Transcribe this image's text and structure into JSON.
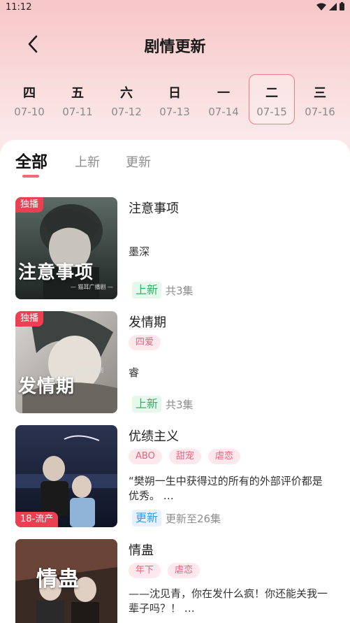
{
  "status_bar": {
    "time": "11:12"
  },
  "header": {
    "title": "剧情更新"
  },
  "days": [
    {
      "week": "四",
      "date": "07-10",
      "selected": false
    },
    {
      "week": "五",
      "date": "07-11",
      "selected": false
    },
    {
      "week": "六",
      "date": "07-12",
      "selected": false
    },
    {
      "week": "日",
      "date": "07-13",
      "selected": false
    },
    {
      "week": "一",
      "date": "07-14",
      "selected": false
    },
    {
      "week": "二",
      "date": "07-15",
      "selected": true
    },
    {
      "week": "三",
      "date": "07-16",
      "selected": false
    }
  ],
  "tabs": [
    {
      "label": "全部",
      "active": true
    },
    {
      "label": "上新",
      "active": false
    },
    {
      "label": "更新",
      "active": false
    }
  ],
  "items": [
    {
      "title": "注意事项",
      "cover_badge": "独播",
      "cover_title": "注意事项",
      "cover_sub": "— 猫耳广播剧 —",
      "tags": [],
      "desc": "墨深",
      "status": "上新",
      "episodes": "共3集"
    },
    {
      "title": "发情期",
      "cover_badge": "独播",
      "cover_title": "发情期",
      "cover_sub": "猫耳广播剧",
      "tags": [
        "四爱"
      ],
      "desc": "睿",
      "status": "上新",
      "episodes": "共3集"
    },
    {
      "title": "优绩主义",
      "cover_badge": "18-流产",
      "cover_title": "",
      "cover_sub": "",
      "tags": [
        "ABO",
        "甜宠",
        "虐恋"
      ],
      "desc": "“樊朔一生中获得过的所有的外部评价都是优秀。 …",
      "status": "更新",
      "episodes": "更新至26集"
    },
    {
      "title": "情蛊",
      "cover_badge": "",
      "cover_title": "情蛊",
      "cover_sub": "",
      "tags": [
        "年下",
        "虐恋"
      ],
      "desc": "——沈见青，你在发什么疯！你还能关我一辈子吗？！ …",
      "status": "",
      "episodes": ""
    }
  ],
  "colors": {
    "accent": "#ef6b78",
    "badge": "#e94152",
    "new_status": "#2fb268",
    "update_status": "#3c99e8"
  }
}
